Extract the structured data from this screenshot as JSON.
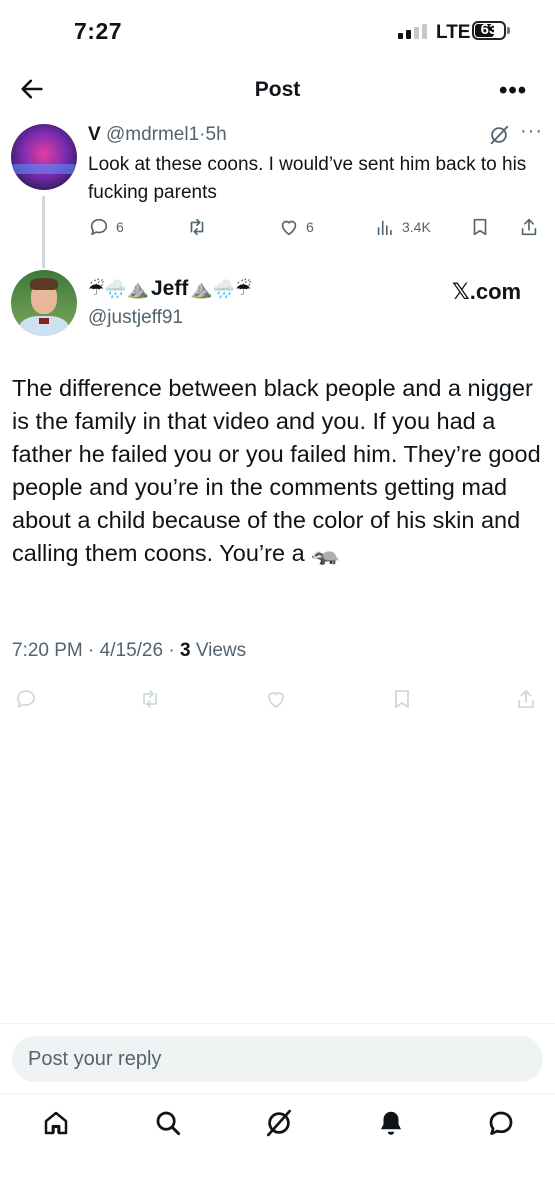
{
  "status_bar": {
    "time": "7:27",
    "network": "LTE",
    "battery": "63"
  },
  "header": {
    "title": "Post",
    "more": "•••"
  },
  "parent_post": {
    "display_name": "V",
    "handle": "@mdrmel1",
    "separator": "·",
    "age": "5h",
    "more": "···",
    "text": "Look at these coons. I would’ve sent him back to his fucking parents",
    "replies": "6",
    "likes": "6",
    "views": "3.4K"
  },
  "main_post": {
    "name_prefix_emoji": "☔🌧️⛰️",
    "display_name": "Jeff",
    "name_suffix_emoji": "⛰️🌧️☔",
    "handle": "@justjeff91",
    "watermark": "𝕏.com",
    "text": "The difference between black people and a nigger is the family in that video and you. If you had a father he failed you or you failed him. They’re good people and you’re in the comments getting mad about a child because of the color of his skin and calling them coons. You’re a 🦡",
    "time": "7:20 PM",
    "date": "4/15/26",
    "separator": "·",
    "views_count": "3",
    "views_label": "Views"
  },
  "reply_bar": {
    "placeholder": "Post your reply"
  },
  "icons": {
    "back": "arrow-left-icon",
    "reply": "comment-icon",
    "repost": "repost-icon",
    "like": "heart-icon",
    "views": "analytics-icon",
    "bookmark": "bookmark-icon",
    "share": "share-icon",
    "grok": "grok-icon",
    "nav": [
      "home-icon",
      "search-icon",
      "grok-icon",
      "bell-icon",
      "messages-icon"
    ]
  },
  "colors": {
    "text": "#0f1419",
    "muted": "#536471",
    "faint": "#cfd9de",
    "surface": "#eff3f4"
  }
}
